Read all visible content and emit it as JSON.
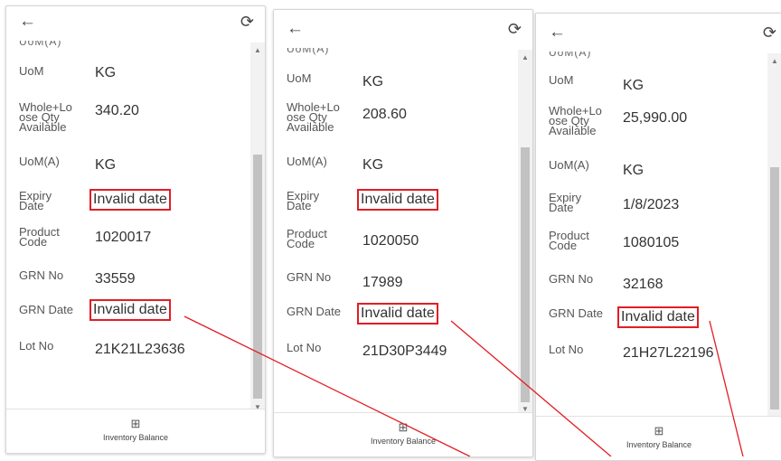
{
  "icons": {
    "back": "arrow-left-icon",
    "refresh": "refresh-icon",
    "nav": "grid-icon"
  },
  "accent": "#e21d24",
  "panels": [
    {
      "cut_label": "UoM(A)",
      "labels": {
        "uom": "UoM",
        "qty": "Whole+Lo ose Qty Available",
        "uoma": "UoM(A)",
        "expiry": "Expiry Date",
        "product": "Product Code",
        "grn": "GRN No",
        "grndate": "GRN Date",
        "lot": "Lot No"
      },
      "values": {
        "uom": "KG",
        "qty": "340.20",
        "uoma": "KG",
        "expiry": "Invalid date",
        "product": "1020017",
        "grn": "33559",
        "grndate": "Invalid date",
        "lot": "21K21L23636"
      },
      "nav_label": "Inventory Balance"
    },
    {
      "cut_label": "UoM(A)",
      "labels": {
        "uom": "UoM",
        "qty": "Whole+Lo ose Qty Available",
        "uoma": "UoM(A)",
        "expiry": "Expiry Date",
        "product": "Product Code",
        "grn": "GRN No",
        "grndate": "GRN Date",
        "lot": "Lot No"
      },
      "values": {
        "uom": "KG",
        "qty": "208.60",
        "uoma": "KG",
        "expiry": "Invalid date",
        "product": "1020050",
        "grn": "17989",
        "grndate": "Invalid date",
        "lot": "21D30P3449"
      },
      "nav_label": "Inventory Balance"
    },
    {
      "cut_label": "UoM(A)",
      "labels": {
        "uom": "UoM",
        "qty": "Whole+Lo ose Qty Available",
        "uoma": "UoM(A)",
        "expiry": "Expiry Date",
        "product": "Product Code",
        "grn": "GRN No",
        "grndate": "GRN Date",
        "lot": "Lot No"
      },
      "values": {
        "uom": "KG",
        "qty": "25,990.00",
        "uoma": "KG",
        "expiry": "1/8/2023",
        "product": "1080105",
        "grn": "32168",
        "grndate": "Invalid date",
        "lot": "21H27L22196"
      },
      "nav_label": "Inventory Balance"
    }
  ]
}
